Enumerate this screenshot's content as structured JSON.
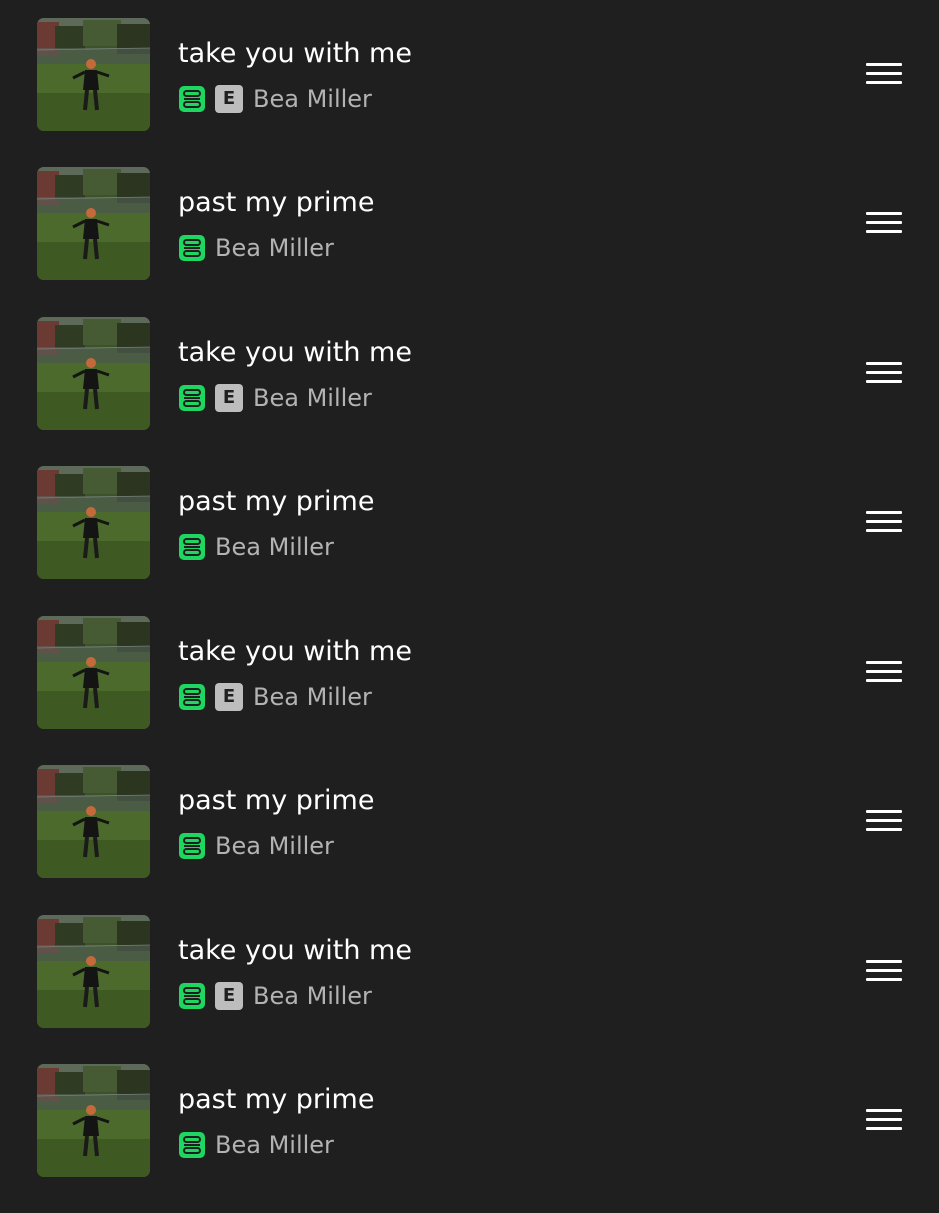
{
  "colors": {
    "background": "#1f1f1f",
    "downloaded_green": "#1ed760",
    "explicit_badge": "#bdbdbd",
    "artist_text": "#b3b3b3"
  },
  "tracks": [
    {
      "title": "take you with me",
      "artist": "Bea Miller",
      "explicit": true,
      "explicit_label": "E",
      "downloaded_icon": "downloaded-icon",
      "reorder_icon": "drag-handle-icon"
    },
    {
      "title": "past my prime",
      "artist": "Bea Miller",
      "explicit": false,
      "downloaded_icon": "downloaded-icon",
      "reorder_icon": "drag-handle-icon"
    },
    {
      "title": "take you with me",
      "artist": "Bea Miller",
      "explicit": true,
      "explicit_label": "E",
      "downloaded_icon": "downloaded-icon",
      "reorder_icon": "drag-handle-icon"
    },
    {
      "title": "past my prime",
      "artist": "Bea Miller",
      "explicit": false,
      "downloaded_icon": "downloaded-icon",
      "reorder_icon": "drag-handle-icon"
    },
    {
      "title": "take you with me",
      "artist": "Bea Miller",
      "explicit": true,
      "explicit_label": "E",
      "downloaded_icon": "downloaded-icon",
      "reorder_icon": "drag-handle-icon"
    },
    {
      "title": "past my prime",
      "artist": "Bea Miller",
      "explicit": false,
      "downloaded_icon": "downloaded-icon",
      "reorder_icon": "drag-handle-icon"
    },
    {
      "title": "take you with me",
      "artist": "Bea Miller",
      "explicit": true,
      "explicit_label": "E",
      "downloaded_icon": "downloaded-icon",
      "reorder_icon": "drag-handle-icon"
    },
    {
      "title": "past my prime",
      "artist": "Bea Miller",
      "explicit": false,
      "downloaded_icon": "downloaded-icon",
      "reorder_icon": "drag-handle-icon"
    }
  ]
}
